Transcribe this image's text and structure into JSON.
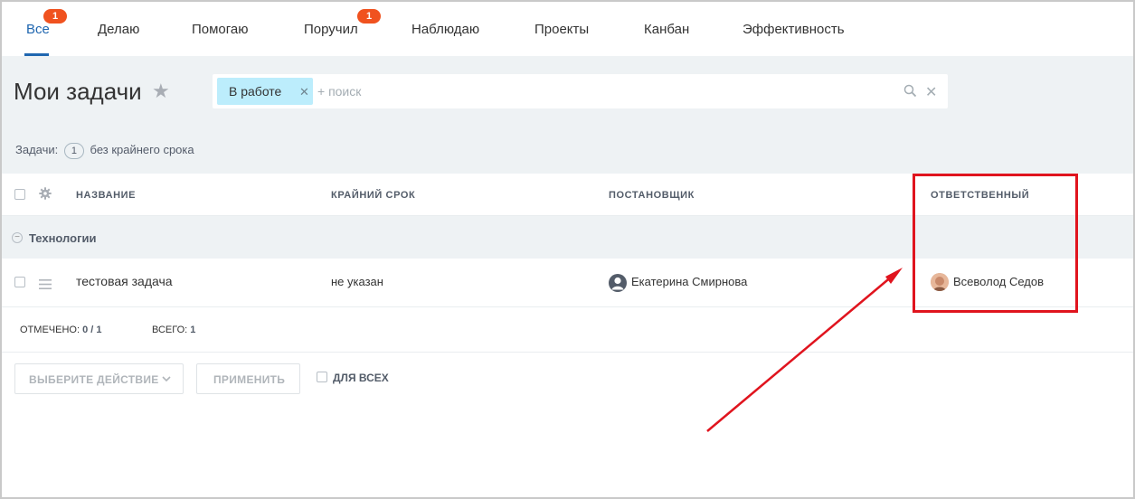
{
  "tabs": [
    {
      "label": "Все",
      "badge": "1",
      "active": true
    },
    {
      "label": "Делаю"
    },
    {
      "label": "Помогаю"
    },
    {
      "label": "Поручил",
      "badge": "1"
    },
    {
      "label": "Наблюдаю"
    },
    {
      "label": "Проекты"
    },
    {
      "label": "Канбан"
    },
    {
      "label": "Эффективность"
    }
  ],
  "header": {
    "title": "Мои задачи",
    "filter_chip": "В работе",
    "search_placeholder": "+ поиск"
  },
  "summary": {
    "prefix": "Задачи:",
    "count": "1",
    "suffix": "без крайнего срока"
  },
  "table": {
    "columns": [
      "НАЗВАНИЕ",
      "КРАЙНИЙ СРОК",
      "ПОСТАНОВЩИК",
      "ОТВЕТСТВЕННЫЙ"
    ],
    "group": "Технологии",
    "rows": [
      {
        "title": "тестовая задача",
        "deadline": "не указан",
        "creator": "Екатерина Смирнова",
        "responsible": "Всеволод Седов"
      }
    ]
  },
  "footer": {
    "selected_label": "ОТМЕЧЕНО:",
    "selected_value": "0 / 1",
    "total_label": "ВСЕГО:",
    "total_value": "1"
  },
  "actions": {
    "select_action": "ВЫБЕРИТЕ ДЕЙСТВИЕ",
    "apply": "ПРИМЕНИТЬ",
    "for_all": "ДЛЯ ВСЕХ"
  },
  "colors": {
    "accent": "#2067b0",
    "badge": "#f0521f",
    "chip": "#bcedfc",
    "annotation": "#e0141e"
  }
}
